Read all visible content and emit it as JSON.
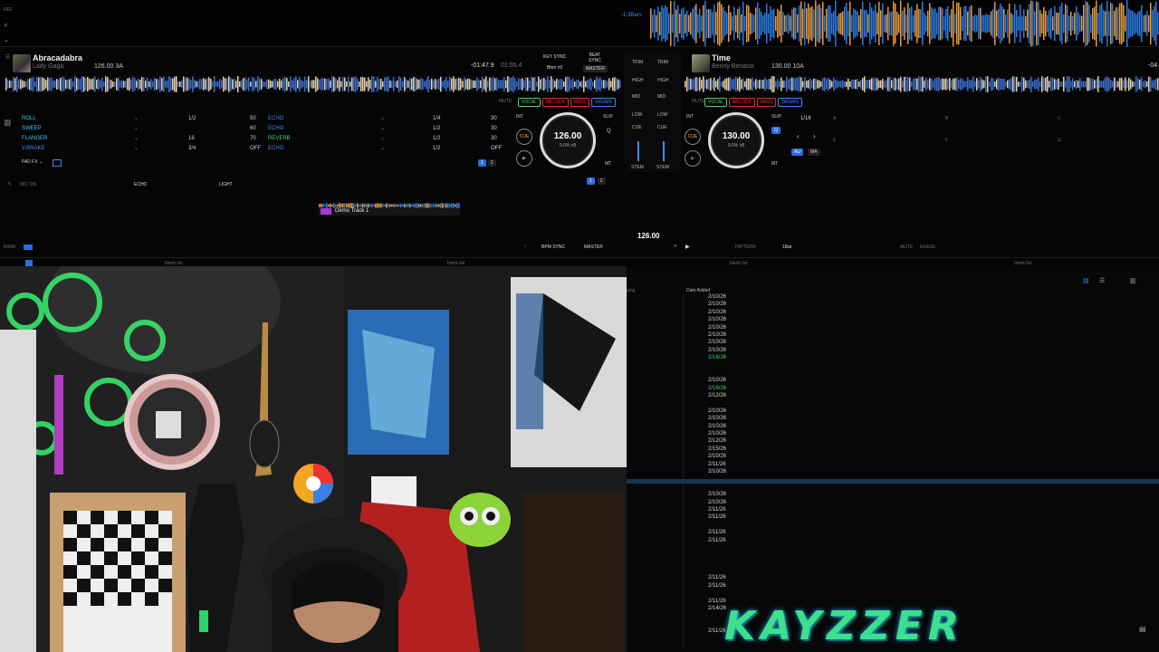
{
  "overview": {
    "left_tag": "REF",
    "bars_label": "-1.3Bars"
  },
  "deck_a": {
    "title": "Abracadabra",
    "artist": "Lady Gaga",
    "bpm_key": "126.00 3A",
    "remaining": "-01:47.9",
    "total": "01:55.4",
    "key_sync": "KEY SYNC",
    "key_offset": "Bbm ±0",
    "beat_sync": "BEAT SYNC",
    "master": "MASTER",
    "mute": "MUTE",
    "stems": [
      "VOCAL",
      "MELODY",
      "BASS",
      "DRUMS"
    ],
    "jog_bpm": "126.00",
    "jog_sub": "0.0% ±8",
    "cue": "CUE",
    "int": "INT",
    "slip": "SLIP",
    "q": "Q",
    "mt": "MT",
    "pads": [
      "1",
      "2"
    ]
  },
  "deck_b": {
    "title": "Time",
    "artist": "Benny Benassi",
    "bpm_key": "130.00 10A",
    "remaining": "-04",
    "mute": "MUTE",
    "stems": [
      "VOCAL",
      "MELODY",
      "BASS",
      "DRUMS"
    ],
    "jog_bpm": "130.00",
    "jog_sub": "0.0% ±8",
    "cue": "CUE",
    "int": "INT",
    "slip": "SLIP",
    "q": "Q",
    "mt": "MT",
    "beat_jump": "1/16",
    "au": "AU",
    "ma": "MA",
    "grid_labels": [
      "A",
      "B",
      "C",
      "E",
      "F",
      "G"
    ]
  },
  "mixer": {
    "trim": "TRIM",
    "high": "HIGH",
    "mid": "MID",
    "low": "LOW",
    "cue": "CUE",
    "stem": "STEM"
  },
  "pad_fx": {
    "left": [
      {
        "name": "ROLL",
        "val": "1/2",
        "pct": "50"
      },
      {
        "name": "SWEEP",
        "val": "",
        "pct": "60"
      },
      {
        "name": "FLANGER",
        "val": "16",
        "pct": "70"
      },
      {
        "name": "V.BRAKE",
        "val": "3/4",
        "pct": "OFF"
      }
    ],
    "right": [
      {
        "name": "ECHO",
        "val": "1/4",
        "pct": "30"
      },
      {
        "name": "ECHO",
        "val": "1/2",
        "pct": "30"
      },
      {
        "name": "REVERB",
        "val": "1/2",
        "pct": "30"
      },
      {
        "name": "ECHO",
        "val": "1/2",
        "pct": "OFF"
      }
    ],
    "label": "PAD FX",
    "pad_nums": [
      "1",
      "2"
    ]
  },
  "fx_bar": {
    "mic": "MIC ON",
    "echo": "ECHO",
    "light": "LIGHT"
  },
  "sampler": {
    "track": "Demo Track 1",
    "bpm": "126.00",
    "bpm_sync": "BPM SYNC",
    "master": "MASTER",
    "bank": "BANK",
    "pattern": "PATTERN",
    "bar": "1Bar",
    "mute": "MUTE",
    "erase": "ERASE"
  },
  "browser": {
    "tabs": [
      "blank list",
      "blank list",
      "blank list",
      "blank list"
    ],
    "col_ping": "ping",
    "col_date": "Date Added",
    "dates": [
      {
        "v": "2/10/26",
        "g": false
      },
      {
        "v": "2/10/26",
        "g": false
      },
      {
        "v": "2/10/26",
        "g": false
      },
      {
        "v": "2/10/26",
        "g": false
      },
      {
        "v": "2/10/26",
        "g": false
      },
      {
        "v": "2/10/26",
        "g": false
      },
      {
        "v": "2/10/26",
        "g": false
      },
      {
        "v": "2/10/26",
        "g": false
      },
      {
        "v": "2/16/26",
        "g": true
      },
      {
        "v": "",
        "g": false
      },
      {
        "v": "",
        "g": false
      },
      {
        "v": "2/10/26",
        "g": false
      },
      {
        "v": "2/16/26",
        "g": true
      },
      {
        "v": "2/12/26",
        "g": false
      },
      {
        "v": "",
        "g": false
      },
      {
        "v": "2/10/26",
        "g": false
      },
      {
        "v": "2/10/26",
        "g": false
      },
      {
        "v": "2/10/26",
        "g": false
      },
      {
        "v": "2/10/26",
        "g": false
      },
      {
        "v": "2/12/26",
        "g": false
      },
      {
        "v": "2/15/26",
        "g": false
      },
      {
        "v": "2/10/26",
        "g": false
      },
      {
        "v": "2/11/26",
        "g": false
      },
      {
        "v": "2/10/26",
        "g": false
      },
      {
        "v": "",
        "g": false
      },
      {
        "v": "",
        "g": false
      },
      {
        "v": "2/10/26",
        "g": false
      },
      {
        "v": "2/10/26",
        "g": false
      },
      {
        "v": "2/11/26",
        "g": false
      },
      {
        "v": "2/11/26",
        "g": false
      },
      {
        "v": "",
        "g": false
      },
      {
        "v": "2/11/26",
        "g": false
      },
      {
        "v": "2/11/26",
        "g": false
      },
      {
        "v": "",
        "g": false
      },
      {
        "v": "",
        "g": false
      },
      {
        "v": "",
        "g": false
      },
      {
        "v": "",
        "g": false
      },
      {
        "v": "2/11/26",
        "g": false
      },
      {
        "v": "2/11/26",
        "g": false
      },
      {
        "v": "",
        "g": false
      },
      {
        "v": "2/11/26",
        "g": false
      },
      {
        "v": "2/14/26",
        "g": false
      },
      {
        "v": "",
        "g": false
      },
      {
        "v": "",
        "g": false
      },
      {
        "v": "2/11/26",
        "g": false
      }
    ]
  },
  "overlay": {
    "logo": "KAYZZER"
  },
  "colors": {
    "accent": "#3d8cf5",
    "wave_orange": "#e89a3c",
    "wave_blue": "#2a7be0",
    "fx_green": "#4bd36b",
    "fx_cyan": "#3fc6f0"
  }
}
